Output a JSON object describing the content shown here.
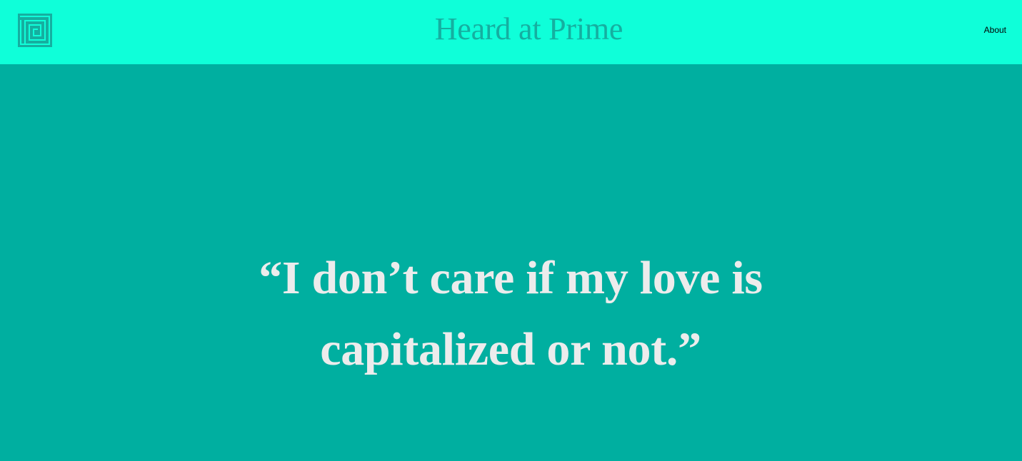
{
  "colors": {
    "header_background": "#0FFFD9",
    "page_background": "#00AFA0",
    "title_color": "#15AFA0",
    "quote_color": "#ECECEC",
    "logo_color": "#15AFA0"
  },
  "header": {
    "logo_icon": "maze-logo-icon",
    "site_title": "Heard at Prime",
    "nav": {
      "about_label": "About"
    }
  },
  "main": {
    "quote_text": "“I don’t care if my love is capitalized or not.”"
  }
}
